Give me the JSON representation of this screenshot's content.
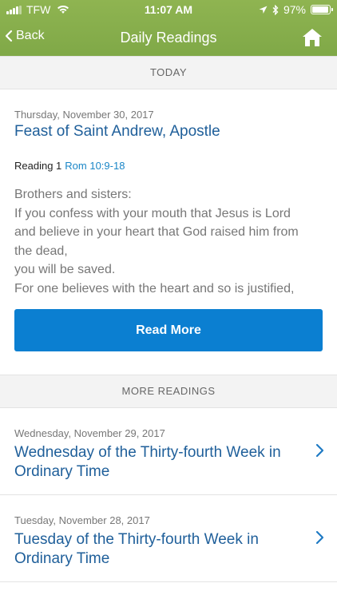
{
  "status_bar": {
    "carrier": "TFW",
    "time": "11:07 AM",
    "battery": "97%",
    "battery_level": 0.97
  },
  "nav": {
    "back_label": "Back",
    "title": "Daily Readings"
  },
  "today": {
    "section_label": "TODAY",
    "date": "Thursday, November 30, 2017",
    "title": "Feast of Saint Andrew, Apostle",
    "reading_label": "Reading 1",
    "reading_ref": "Rom 10:9-18",
    "excerpt_lines": [
      "Brothers and sisters:",
      "If you confess with your mouth that Jesus is Lord",
      "and believe in your heart that God raised him from",
      "the dead,",
      "you will be saved.",
      "For one believes with the heart and so is justified,"
    ],
    "read_more_label": "Read More"
  },
  "more": {
    "section_label": "MORE READINGS",
    "items": [
      {
        "date": "Wednesday, November 29, 2017",
        "title": "Wednesday of the Thirty-fourth Week in Ordinary Time"
      },
      {
        "date": "Tuesday, November 28, 2017",
        "title": "Tuesday of the Thirty-fourth Week in Ordinary Time"
      }
    ]
  },
  "colors": {
    "header_green": "#8fb451",
    "link_blue": "#1f5f9a",
    "button_blue": "#0b7fd1"
  }
}
